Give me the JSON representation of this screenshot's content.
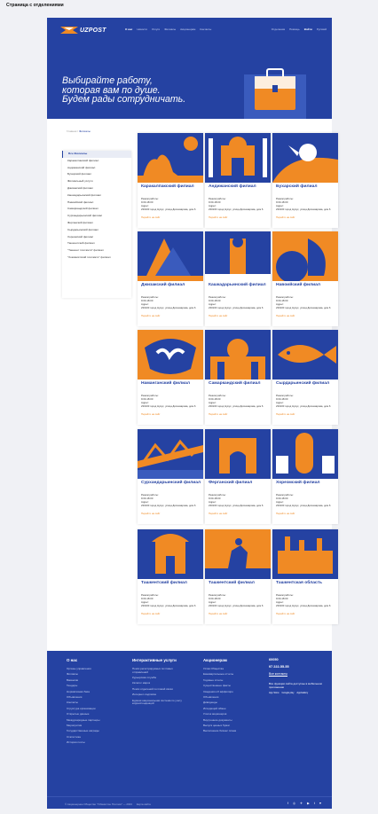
{
  "page_label": "Страница с отделениями",
  "header": {
    "logo": "UZPOST",
    "nav": [
      "О нас",
      "Новости",
      "Услуги",
      "Филиалы",
      "Акционерам",
      "Контакты"
    ],
    "nav_right": [
      "Отделения",
      "Помощь",
      "Войти",
      "Русский"
    ]
  },
  "hero": {
    "title": "Выбирайте работу,\nкоторая вам по душе.\nБудем рады сотрудничать."
  },
  "breadcrumb": {
    "home": "Главная",
    "sep": "/",
    "current": "Филиалы"
  },
  "sidebar": {
    "items": [
      "Все Филиалы",
      "Каракалпакский филиал",
      "Андижанский филиал",
      "Бухарский филиал",
      "Филиальный услуги",
      "Джизакский филиал",
      "Кашкадарьинский филиал",
      "Навоийский филиал",
      "Самаркандский филиал",
      "Сурхандарьинский филиал",
      "Ферганский филиал",
      "Сырдарьинский филиал",
      "Хорезмский филиал",
      "Ташкентский филиал",
      "\"Ташкент почтамти\" филиал",
      "\"Хокимиятский почтамти\" филиал"
    ]
  },
  "card_common": {
    "hours_label": "Режим работы:",
    "hours": "9:00-18:00",
    "addr_label": "Адрес:",
    "addr": "230100 город Нукус, улица Досназарова, дом 6",
    "link": "Перейти на сайт"
  },
  "cards": [
    {
      "title": "Каракалпакский филиал",
      "bg": "#2542a2"
    },
    {
      "title": "Андижанский филиал",
      "bg": "#2542a2"
    },
    {
      "title": "Бухарский филиал",
      "bg": "#2542a2"
    },
    {
      "title": "Джизакский филиал",
      "bg": "#2542a2"
    },
    {
      "title": "Кашкадарьинский филиал",
      "bg": "#2542a2"
    },
    {
      "title": "Навоийский филиал",
      "bg": "#f08a24"
    },
    {
      "title": "Наманганский филиал",
      "bg": "#f08a24"
    },
    {
      "title": "Самаркандский филиал",
      "bg": "#2542a2"
    },
    {
      "title": "Сырдарьинский филиал",
      "bg": "#2542a2"
    },
    {
      "title": "Сурхандарьинский филиал",
      "bg": "#2542a2"
    },
    {
      "title": "Ферганский филиал",
      "bg": "#2542a2"
    },
    {
      "title": "Хорезмский филиал",
      "bg": "#2542a2"
    },
    {
      "title": "Ташкентский филиал",
      "bg": "#2542a2"
    },
    {
      "title": "Ташкентский филиал",
      "bg": "#f08a24"
    },
    {
      "title": "Ташкентская область",
      "bg": "#2542a2"
    }
  ],
  "footer": {
    "col1": {
      "title": "О нас",
      "items": [
        "Органы управления",
        "Филиалы",
        "Вакансии",
        "Тендеры",
        "Нормативная база",
        "Объявления",
        "Контакты",
        "Структура организации",
        "Открытые данные",
        "Международные партнеры",
        "Меропрития",
        "Государственные награды",
        "Статистика",
        "История почты"
      ]
    },
    "col2": {
      "title": "Интерактивные услуги",
      "items": [
        "Поиск регистрируемых почтовых отправлений",
        "Курьерская служба",
        "Каталог марок",
        "Поиск отделений почтовой связи",
        "Интернет-подписка",
        "Единая национальная система по учету корреспонденций"
      ]
    },
    "col3": {
      "title": "Акционерам",
      "items": [
        "Устав Общества",
        "Ежеквартальные отчеты",
        "Годовые отчеты",
        "Существенные факты",
        "Сведения об аффилиро",
        "Объявления",
        "Дивиденды",
        "Исходящий обмен",
        "Уголок акционеров",
        "Внутренние документы",
        "Выпуск ценных бумаг",
        "Выполнение бизнес плана"
      ]
    },
    "col4": {
      "short": "60050",
      "phone": "97 222-55-55",
      "contacts": "Все контакты",
      "apps_text": "Все функции сайта доступны в мобильном приложении",
      "apps": [
        "App Store",
        "Google play",
        "AppGallery"
      ]
    },
    "copyright": "© Акционерное Общество \"Узбекистон Почтаси\" — 2023",
    "copyright_extra": "Карта сайта",
    "social": [
      "f",
      "◎",
      "✈",
      "▶",
      "t",
      "♥"
    ]
  },
  "colors": {
    "primary": "#2542a2",
    "accent": "#f08a24"
  }
}
